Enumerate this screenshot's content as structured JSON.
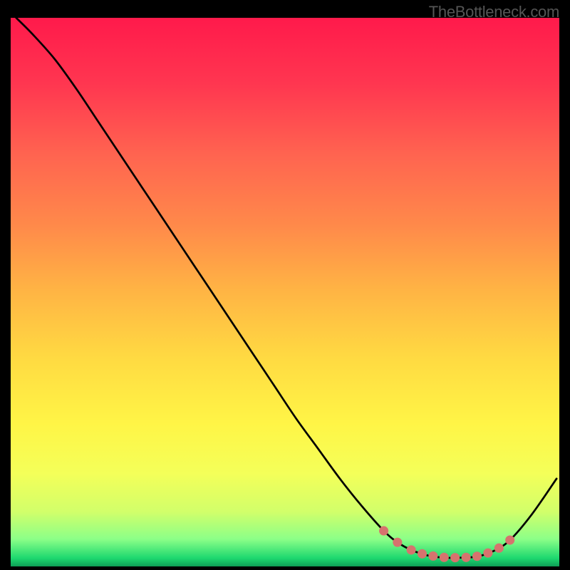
{
  "watermark": "TheBottleneck.com",
  "chart_data": {
    "type": "line",
    "title": "",
    "xlabel": "",
    "ylabel": "",
    "xlim": [
      0,
      100
    ],
    "ylim": [
      0,
      100
    ],
    "grid": false,
    "legend": false,
    "series": [
      {
        "name": "bottleneck-curve",
        "x": [
          1,
          4,
          8,
          12,
          16,
          20,
          24,
          28,
          32,
          36,
          40,
          44,
          48,
          52,
          56,
          60,
          64,
          68,
          70.5,
          73,
          76,
          79,
          82,
          85,
          88,
          91,
          95,
          99.5
        ],
        "y": [
          100,
          97,
          92.5,
          87,
          81,
          75,
          69,
          63,
          57,
          51,
          45,
          39,
          33,
          27,
          21.5,
          16,
          11,
          6.5,
          4.4,
          3.0,
          2.0,
          1.6,
          1.6,
          1.8,
          2.8,
          4.8,
          9.5,
          16
        ]
      }
    ],
    "markers": {
      "name": "valley-dots",
      "color": "#d6736e",
      "points": [
        {
          "x": 68,
          "y": 6.5
        },
        {
          "x": 70.5,
          "y": 4.4
        },
        {
          "x": 73,
          "y": 3.0
        },
        {
          "x": 75,
          "y": 2.3
        },
        {
          "x": 77,
          "y": 1.9
        },
        {
          "x": 79,
          "y": 1.65
        },
        {
          "x": 81,
          "y": 1.6
        },
        {
          "x": 83,
          "y": 1.65
        },
        {
          "x": 85,
          "y": 1.85
        },
        {
          "x": 87,
          "y": 2.45
        },
        {
          "x": 89,
          "y": 3.35
        },
        {
          "x": 91,
          "y": 4.8
        }
      ]
    },
    "background_gradient": {
      "stops": [
        {
          "offset": 0.0,
          "color": "#ff1a4b"
        },
        {
          "offset": 0.12,
          "color": "#ff3650"
        },
        {
          "offset": 0.25,
          "color": "#ff6450"
        },
        {
          "offset": 0.38,
          "color": "#ff8a4a"
        },
        {
          "offset": 0.5,
          "color": "#ffb544"
        },
        {
          "offset": 0.62,
          "color": "#ffda42"
        },
        {
          "offset": 0.74,
          "color": "#fff546"
        },
        {
          "offset": 0.83,
          "color": "#f4ff59"
        },
        {
          "offset": 0.9,
          "color": "#d2ff6a"
        },
        {
          "offset": 0.95,
          "color": "#8cff88"
        },
        {
          "offset": 0.985,
          "color": "#1dd86f"
        },
        {
          "offset": 1.0,
          "color": "#0e9e56"
        }
      ]
    }
  }
}
